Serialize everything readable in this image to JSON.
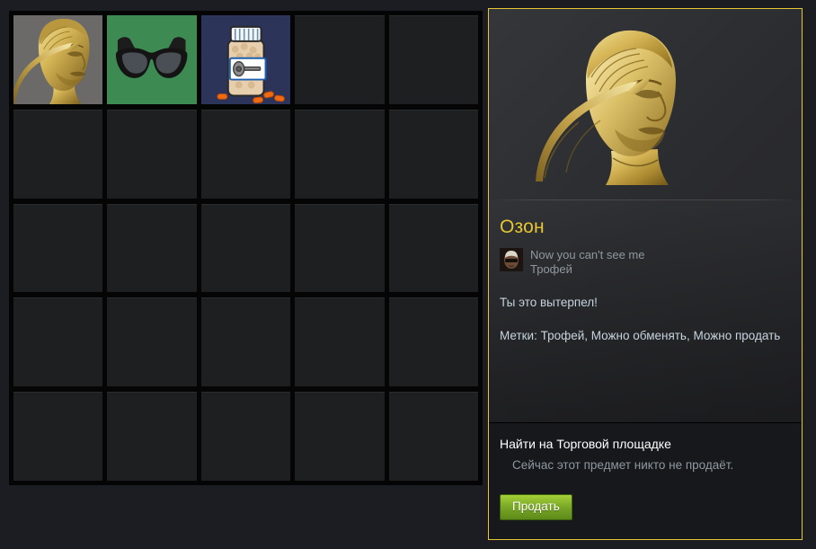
{
  "inventory": {
    "columns": 5,
    "rows": 5,
    "cells": [
      {
        "index": 0,
        "name": "Озон",
        "icon": "gold-bust-salute",
        "selected": true,
        "empty": false,
        "bg": "#6c6a68"
      },
      {
        "index": 1,
        "name": "Sunglasses",
        "icon": "black-sunglasses",
        "selected": false,
        "empty": false,
        "bg": "#3d8b52"
      },
      {
        "index": 2,
        "name": "Pill Bottle",
        "icon": "pill-bottle",
        "selected": false,
        "empty": false,
        "bg": "#2c3559"
      },
      {
        "index": 3,
        "name": "",
        "icon": "",
        "selected": false,
        "empty": true,
        "bg": "#1e1f21"
      },
      {
        "index": 4,
        "name": "",
        "icon": "",
        "selected": false,
        "empty": true,
        "bg": "#1e1f21"
      },
      {
        "index": 5,
        "name": "",
        "icon": "",
        "selected": false,
        "empty": true,
        "bg": "#1e1f21"
      },
      {
        "index": 6,
        "name": "",
        "icon": "",
        "selected": false,
        "empty": true,
        "bg": "#1e1f21"
      },
      {
        "index": 7,
        "name": "",
        "icon": "",
        "selected": false,
        "empty": true,
        "bg": "#1e1f21"
      },
      {
        "index": 8,
        "name": "",
        "icon": "",
        "selected": false,
        "empty": true,
        "bg": "#1e1f21"
      },
      {
        "index": 9,
        "name": "",
        "icon": "",
        "selected": false,
        "empty": true,
        "bg": "#1e1f21"
      },
      {
        "index": 10,
        "name": "",
        "icon": "",
        "selected": false,
        "empty": true,
        "bg": "#1e1f21"
      },
      {
        "index": 11,
        "name": "",
        "icon": "",
        "selected": false,
        "empty": true,
        "bg": "#1e1f21"
      },
      {
        "index": 12,
        "name": "",
        "icon": "",
        "selected": false,
        "empty": true,
        "bg": "#1e1f21"
      },
      {
        "index": 13,
        "name": "",
        "icon": "",
        "selected": false,
        "empty": true,
        "bg": "#1e1f21"
      },
      {
        "index": 14,
        "name": "",
        "icon": "",
        "selected": false,
        "empty": true,
        "bg": "#1e1f21"
      },
      {
        "index": 15,
        "name": "",
        "icon": "",
        "selected": false,
        "empty": true,
        "bg": "#1e1f21"
      },
      {
        "index": 16,
        "name": "",
        "icon": "",
        "selected": false,
        "empty": true,
        "bg": "#1e1f21"
      },
      {
        "index": 17,
        "name": "",
        "icon": "",
        "selected": false,
        "empty": true,
        "bg": "#1e1f21"
      },
      {
        "index": 18,
        "name": "",
        "icon": "",
        "selected": false,
        "empty": true,
        "bg": "#1e1f21"
      },
      {
        "index": 19,
        "name": "",
        "icon": "",
        "selected": false,
        "empty": true,
        "bg": "#1e1f21"
      },
      {
        "index": 20,
        "name": "",
        "icon": "",
        "selected": false,
        "empty": true,
        "bg": "#1e1f21"
      },
      {
        "index": 21,
        "name": "",
        "icon": "",
        "selected": false,
        "empty": true,
        "bg": "#1e1f21"
      },
      {
        "index": 22,
        "name": "",
        "icon": "",
        "selected": false,
        "empty": true,
        "bg": "#1e1f21"
      },
      {
        "index": 23,
        "name": "",
        "icon": "",
        "selected": false,
        "empty": true,
        "bg": "#1e1f21"
      },
      {
        "index": 24,
        "name": "",
        "icon": "",
        "selected": false,
        "empty": true,
        "bg": "#1e1f21"
      }
    ]
  },
  "detail": {
    "hero_icon": "gold-bust-salute",
    "name": "Озон",
    "name_color": "#e6c533",
    "border_color": "#e4c834",
    "game_icon": "game-avatar-sunglasses-face",
    "origin_game": "Now you can't see me",
    "origin_type": "Трофей",
    "flavor_text": "Ты это вытерпел!",
    "tags_text": "Метки: Трофей, Можно обменять, Можно продать"
  },
  "market": {
    "heading": "Найти на Торговой площадке",
    "status": "Сейчас этот предмет никто не продаёт.",
    "sell_label": "Продать",
    "sell_color": "#7aa828"
  }
}
